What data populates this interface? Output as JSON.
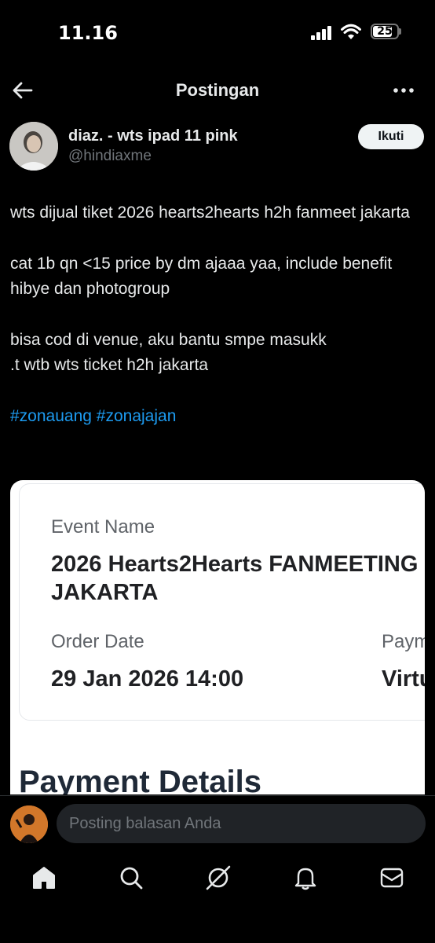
{
  "status_bar": {
    "time": "11.16",
    "battery": "25"
  },
  "header": {
    "title": "Postingan"
  },
  "author": {
    "name": "diaz. - wts ipad 11 pink",
    "handle": "@hindiaxme",
    "follow_label": "Ikuti"
  },
  "post": {
    "paragraphs": [
      "wts dijual tiket 2026 hearts2hearts h2h fanmeet jakarta",
      "cat 1b qn <15 price by dm ajaaa yaa, include benefit hibye dan photogroup",
      "bisa cod di venue, aku bantu smpe masukk\n.t wtb wts ticket h2h jakarta"
    ],
    "hashtags": [
      "#zonauang",
      "#zonajajan"
    ]
  },
  "media": {
    "event_name_label": "Event Name",
    "event_name_line1": "2026 Hearts2Hearts FANMEETING",
    "event_name_line2": "JAKARTA",
    "order_date_label": "Order Date",
    "order_date_value": "29 Jan 2026 14:00",
    "payment_label_partial": "Paym",
    "payment_value_partial": "Virtu",
    "section_title": "Payment Details"
  },
  "reply": {
    "placeholder": "Posting balasan Anda"
  },
  "nav_icons": [
    "home-icon",
    "search-icon",
    "grok-icon",
    "notifications-icon",
    "messages-icon"
  ],
  "colors": {
    "background": "#000000",
    "text": "#e7e9ea",
    "muted": "#71767b",
    "link": "#1d9bf0"
  }
}
